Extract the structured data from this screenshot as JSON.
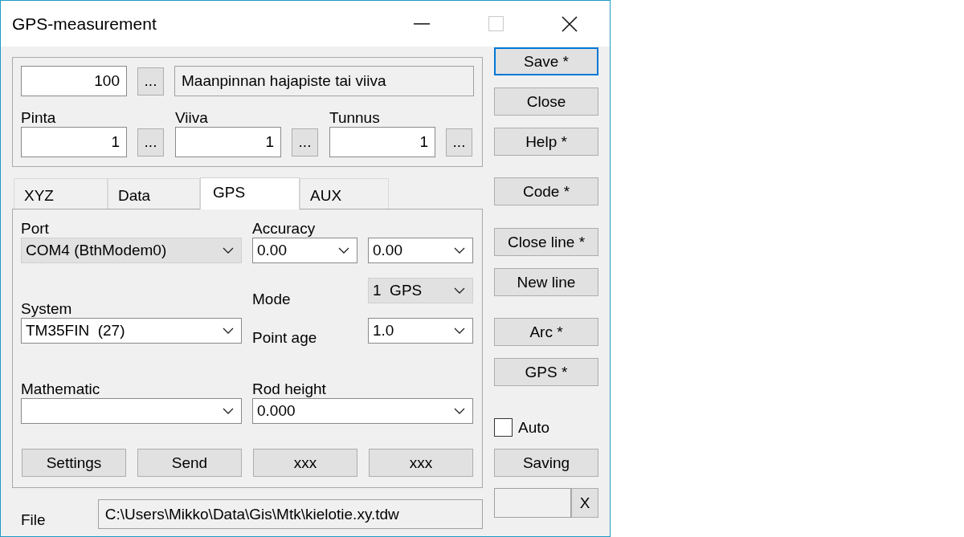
{
  "window": {
    "title": "GPS-measurement",
    "controls": [
      {
        "kind": "minimize",
        "disabled": false
      },
      {
        "kind": "maximize",
        "disabled": true
      },
      {
        "kind": "close",
        "disabled": false
      }
    ]
  },
  "header": {
    "code": "100",
    "code_button": "...",
    "description": "Maanpinnan hajapiste tai viiva",
    "fields": [
      {
        "label": "Pinta",
        "value": "1",
        "button": "..."
      },
      {
        "label": "Viiva",
        "value": "1",
        "button": "..."
      },
      {
        "label": "Tunnus",
        "value": "1",
        "button": "..."
      }
    ]
  },
  "tabs": [
    {
      "label": "XYZ",
      "selected": false
    },
    {
      "label": "Data",
      "selected": false
    },
    {
      "label": "GPS",
      "selected": true
    },
    {
      "label": "AUX",
      "selected": false
    }
  ],
  "gps_panel": {
    "port": {
      "label": "Port",
      "kind": "list",
      "value": "COM4 (BthModem0)"
    },
    "accuracy": {
      "label": "Accuracy",
      "selects": [
        {
          "kind": "combo",
          "value": "0.00"
        },
        {
          "kind": "combo",
          "value": "0.00"
        }
      ]
    },
    "mode": {
      "label": "Mode",
      "kind": "list",
      "value": "1  GPS"
    },
    "system": {
      "label": "System",
      "kind": "combo",
      "value": "TM35FIN  (27)"
    },
    "point_age": {
      "label": "Point age",
      "kind": "combo",
      "value": "1.0"
    },
    "mathematic": {
      "label": "Mathematic",
      "kind": "combo"
    },
    "rod_height": {
      "label": "Rod height",
      "kind": "combo",
      "value": "0.000"
    },
    "buttons": [
      "Settings",
      "Send",
      "xxx",
      "xxx"
    ]
  },
  "file": {
    "label": "File",
    "path": "C:\\Users\\Mikko\\Data\\Gis\\Mtk\\kielotie.xy.tdw"
  },
  "side": [
    {
      "kind": "button",
      "label": "Save *",
      "focused": true
    },
    {
      "kind": "button",
      "label": "Close",
      "focused": false
    },
    {
      "kind": "button",
      "label": "Help *",
      "focused": false
    },
    {
      "kind": "button",
      "label": "Code *",
      "focused": false
    },
    {
      "kind": "button",
      "label": "Close line *",
      "focused": false
    },
    {
      "kind": "button",
      "label": "New line",
      "focused": false
    },
    {
      "kind": "button",
      "label": "Arc *",
      "focused": false
    },
    {
      "kind": "button",
      "label": "GPS *",
      "focused": false
    },
    {
      "kind": "checkbox",
      "label": "Auto",
      "checked": false
    },
    {
      "kind": "button",
      "label": "Saving",
      "focused": false
    }
  ],
  "extra": {
    "clear_button": "X"
  }
}
